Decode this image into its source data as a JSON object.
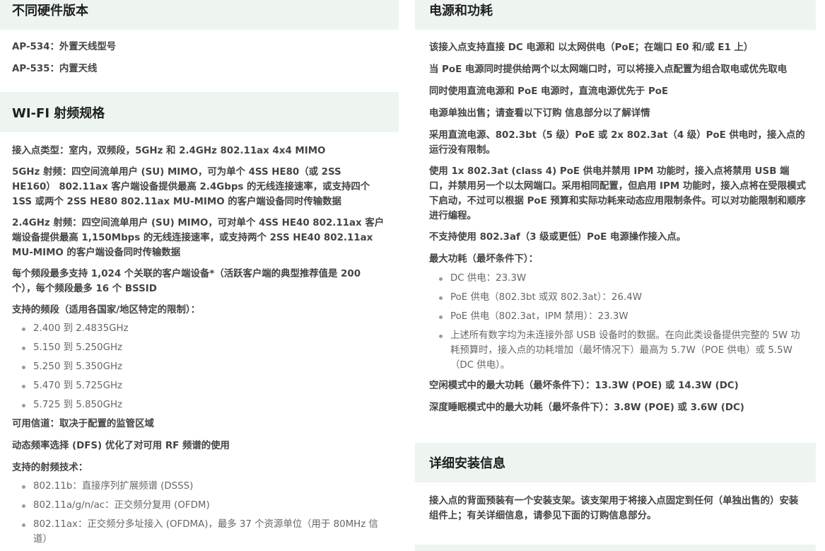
{
  "left": {
    "sec1": {
      "title": "不同硬件版本",
      "items": [
        "AP-534：外置天线型号",
        "AP-535：内置天线"
      ]
    },
    "sec2": {
      "title": "WI-FI 射频规格",
      "p1": "接入点类型：室内，双频段，5GHz 和 2.4GHz 802.11ax 4x4 MIMO",
      "p2": "5GHz 射频：四空间流单用户 (SU) MIMO，可为单个 4SS HE80（或 2SS HE160） 802.11ax 客户端设备提供最高 2.4Gbps 的无线连接速率，或支持四个 1SS 或两个 2SS HE80 802.11ax MU-MIMO 的客户端设备同时传输数据",
      "p3": "2.4GHz 射频：四空间流单用户 (SU) MIMO，可对单个 4SS HE40 802.11ax 客户端设备提供最高 1,150Mbps 的无线连接速率，或支持两个 2SS HE40 802.11ax MU-MIMO 的客户端设备同时传输数据",
      "p4": "每个频段最多支持 1,024 个关联的客户端设备*（活跃客户端的典型推荐值是 200 个），每个频段最多 16 个 BSSID",
      "p5": "支持的频段（适用各国家/地区特定的限制）：",
      "bands": [
        "2.400 到 2.4835GHz",
        "5.150 到 5.250GHz",
        "5.250 到 5.350GHz",
        "5.470 到 5.725GHz",
        "5.725 到 5.850GHz"
      ],
      "p6": "可用信道：取决于配置的监管区域",
      "p7": "动态频率选择 (DFS) 优化了对可用 RF 频谱的使用",
      "p8": "支持的射频技术：",
      "tech": [
        "802.11b：直接序列扩展频谱 (DSSS)",
        "802.11a/g/n/ac：正交频分复用 (OFDM)",
        "802.11ax：正交频分多址接入 (OFDMA)，最多 37 个资源单位（用于 80MHz 信道）"
      ]
    }
  },
  "right": {
    "sec1": {
      "title": "电源和功耗",
      "p1": "该接入点支持直接 DC 电源和 以太网供电（PoE；在端口 E0 和/或 E1 上）",
      "p2": "当 PoE 电源同时提供给两个以太网端口时，可以将接入点配置为组合取电或优先取电",
      "p3": "同时使用直流电源和 PoE 电源时，直流电源优先于 PoE",
      "p4": "电源单独出售；请查看以下订购 信息部分以了解详情",
      "p5": "采用直流电源、802.3bt（5 级）PoE 或 2x 802.3at（4 级）PoE 供电时，接入点的运行没有限制。",
      "p6": "使用 1x 802.3at (class 4) PoE 供电并禁用 IPM 功能时，接入点将禁用 USB 端口，并禁用另一个以太网端口。采用相同配置，但启用 IPM 功能时，接入点将在受限模式下启动，不过可以根据 PoE 预算和实际功耗来动态应用限制条件。可以对功能限制和顺序进行编程。",
      "p7": "不支持使用 802.3af（3 级或更低）PoE 电源操作接入点。",
      "p8": "最大功耗（最坏条件下）：",
      "power": [
        "DC 供电：23.3W",
        "PoE 供电（802.3bt 或双 802.3at）：26.4W",
        "PoE 供电（802.3at，IPM 禁用）：23.3W",
        "上述所有数字均为未连接外部 USB 设备时的数据。在向此类设备提供完整的 5W 功耗预算时，接入点的功耗增加（最坏情况下）最高为 5.7W（POE 供电）或 5.5W（DC 供电）。"
      ],
      "p9": "空闲模式中的最大功耗（最坏条件下）：13.3W (POE) 或 14.3W (DC)",
      "p10": "深度睡眠模式中的最大功耗（最坏条件下）：3.8W (POE) 或 3.6W (DC)"
    },
    "sec2": {
      "title": "详细安装信息",
      "p1": "接入点的背面预装有一个安装支架。该支架用于将接入点固定到任何（单独出售的）安装组件上；有关详细信息，请参见下面的订购信息部分。"
    }
  }
}
